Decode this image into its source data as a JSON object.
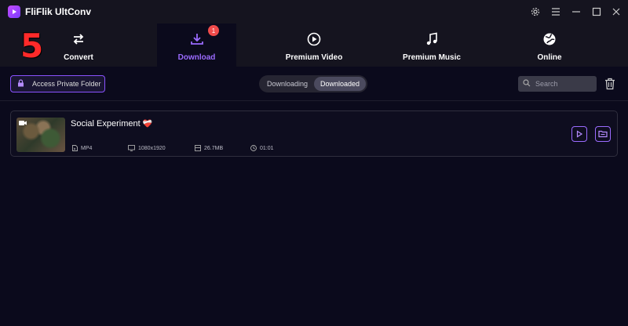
{
  "app": {
    "title": "FliFlik UltConv",
    "overlay_number": "5"
  },
  "nav": {
    "tabs": [
      {
        "label": "Convert",
        "icon": "swap-arrows-icon"
      },
      {
        "label": "Download",
        "icon": "download-icon",
        "badge": "1",
        "active": true
      },
      {
        "label": "Premium Video",
        "icon": "play-circle-icon"
      },
      {
        "label": "Premium Music",
        "icon": "music-note-icon"
      },
      {
        "label": "Online",
        "icon": "globe-icon"
      }
    ]
  },
  "toolbar": {
    "private_folder_label": "Access Private Folder",
    "segments": [
      {
        "label": "Downloading",
        "active": false
      },
      {
        "label": "Downloaded",
        "active": true
      }
    ],
    "search_placeholder": "Search"
  },
  "items": [
    {
      "title": "Social Experiment",
      "title_emoji": "❤️‍🩹",
      "format": "MP4",
      "resolution": "1080x1920",
      "size": "26.7MB",
      "duration": "01:01"
    }
  ],
  "colors": {
    "accent": "#9b6bff",
    "badge": "#f04b4b",
    "background": "#0b0a1c",
    "header": "#15141f"
  }
}
